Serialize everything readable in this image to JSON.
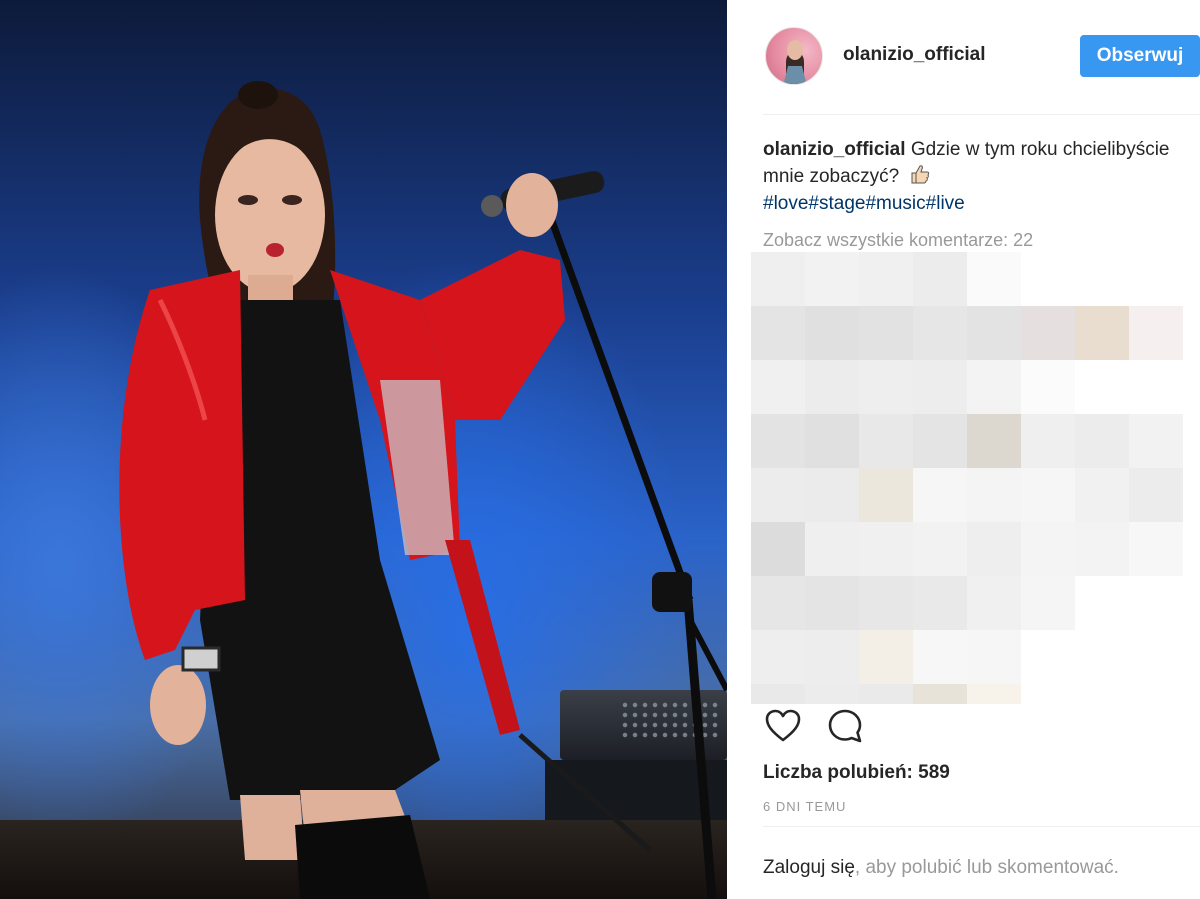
{
  "post": {
    "username": "olanizio_official",
    "follow_label": "Obserwuj",
    "caption_user": "olanizio_official",
    "caption_text": "Gdzie w tym roku chcielibyście mnie zobaczyć?",
    "caption_tags": "#love#stage#music#live",
    "view_all_comments": "Zobacz wszystkie komentarze: 22",
    "likes": "Liczba polubień: 589",
    "timestamp": "6 DNI TEMU",
    "login_link": "Zaloguj się",
    "login_rest": ", aby polubić lub skomentować."
  },
  "icons": {
    "like": "heart-icon",
    "comment": "comment-bubble-icon",
    "emoji": "thumbs-up-emoji"
  },
  "colors": {
    "follow_button": "#3897f0",
    "hashtag": "#003569",
    "muted_text": "#999999",
    "primary_text": "#262626"
  }
}
